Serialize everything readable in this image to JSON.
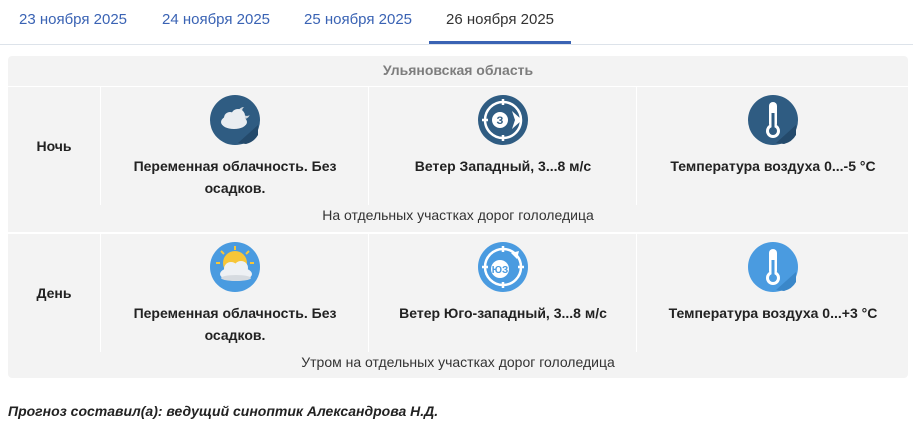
{
  "tabs": [
    {
      "label": "23 ноября 2025",
      "active": false
    },
    {
      "label": "24 ноября 2025",
      "active": false
    },
    {
      "label": "25 ноября 2025",
      "active": false
    },
    {
      "label": "26 ноября 2025",
      "active": true
    }
  ],
  "region": "Ульяновская область",
  "periods": [
    {
      "name": "Ночь",
      "cloud": {
        "icon": "night-cloud-icon",
        "text": "Переменная облачность. Без осадков."
      },
      "wind": {
        "icon": "wind-west-icon",
        "direction_letter": "З",
        "text": "Ветер Западный, 3...8 м/с"
      },
      "temperature": {
        "icon": "thermometer-icon",
        "text": "Температура воздуха 0...-5 °C"
      },
      "note": "На отдельных участках дорог гололедица"
    },
    {
      "name": "День",
      "cloud": {
        "icon": "sun-cloud-icon",
        "text": "Переменная облачность. Без осадков."
      },
      "wind": {
        "icon": "wind-southwest-icon",
        "direction_letter": "ЮЗ",
        "text": "Ветер Юго-западный, 3...8 м/с"
      },
      "temperature": {
        "icon": "thermometer-icon",
        "text": "Температура воздуха 0...+3 °C"
      },
      "note": "Утром на отдельных участках дорог гололедица"
    }
  ],
  "footer": "Прогноз составил(а): ведущий синоптик Александрова Н.Д.",
  "colors": {
    "accent": "#3a63b4",
    "night_icon": "#2f5c82",
    "day_icon": "#4a9be0",
    "panel_bg": "#f3f3f3"
  }
}
